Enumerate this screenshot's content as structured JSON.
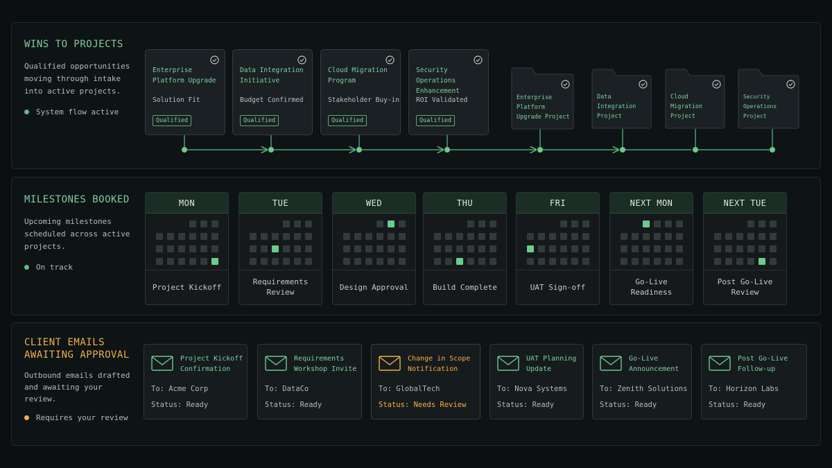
{
  "colors": {
    "accent": "#7ed09a",
    "warning": "#f0b13d",
    "background": "#0c0f12"
  },
  "wins": {
    "title": "WINS TO PROJECTS",
    "description": "Qualified opportunities moving through intake into active projects.",
    "status": "System flow active",
    "opportunities": [
      {
        "title": "Enterprise Platform Upgrade",
        "criteria": "Solution Fit",
        "badge": "Qualified"
      },
      {
        "title": "Data Integration Initiative",
        "criteria": "Budget Confirmed",
        "badge": "Qualified"
      },
      {
        "title": "Cloud Migration Program",
        "criteria": "Stakeholder Buy-in",
        "badge": "Qualified"
      },
      {
        "title": "Security Operations Enhancement",
        "criteria": "ROI Validated",
        "badge": "Qualified"
      }
    ],
    "projects": [
      {
        "title": "Enterprise Platform Upgrade Project"
      },
      {
        "title": "Data Integration Project"
      },
      {
        "title": "Cloud Migration Project"
      },
      {
        "title": "Security Operations Project"
      }
    ]
  },
  "milestones": {
    "title": "MILESTONES BOOKED",
    "description": "Upcoming milestones scheduled across active projects.",
    "status": "On track",
    "days": [
      {
        "day": "MON",
        "label": "Project Kickoff"
      },
      {
        "day": "TUE",
        "label": "Requirements Review"
      },
      {
        "day": "WED",
        "label": "Design Approval"
      },
      {
        "day": "THU",
        "label": "Build Complete"
      },
      {
        "day": "FRI",
        "label": "UAT Sign-off"
      },
      {
        "day": "NEXT MON",
        "label": "Go-Live Readiness"
      },
      {
        "day": "NEXT TUE",
        "label": "Post Go-Live Review"
      }
    ]
  },
  "emails": {
    "title": "CLIENT EMAILS AWAITING APPROVAL",
    "description": "Outbound emails drafted and awaiting your review.",
    "status": "Requires your review",
    "items": [
      {
        "title": "Project Kickoff Confirmation",
        "to": "To: Acme Corp",
        "status": "Status: Ready"
      },
      {
        "title": "Requirements Workshop Invite",
        "to": "To: DataCo",
        "status": "Status: Ready"
      },
      {
        "title": "Change in Scope Notification",
        "to": "To: GlobalTech",
        "status": "Status: Needs Review"
      },
      {
        "title": "UAT Planning Update",
        "to": "To: Nova Systems",
        "status": "Status: Ready"
      },
      {
        "title": "Go-Live Announcement",
        "to": "To: Zenith Solutions",
        "status": "Status: Ready"
      },
      {
        "title": "Post Go-Live Follow-up",
        "to": "To: Horizon Labs",
        "status": "Status: Ready"
      }
    ]
  }
}
